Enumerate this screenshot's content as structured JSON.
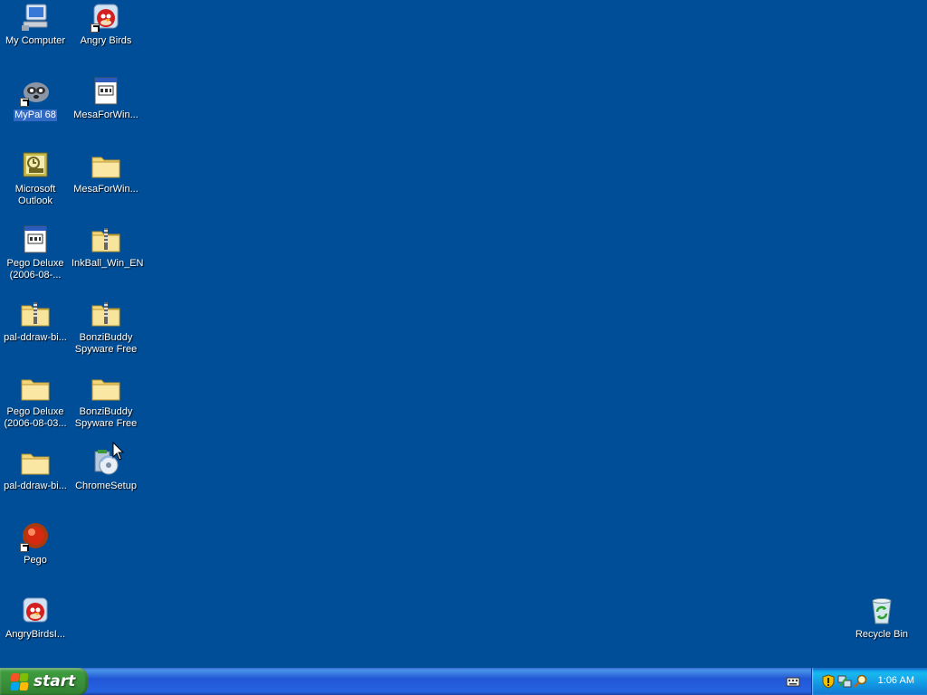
{
  "desktop": {
    "background_color": "#004e98",
    "icons": [
      {
        "label": "My Computer",
        "icon": "my-computer-icon"
      },
      {
        "label": "Angry Birds",
        "icon": "angry-birds-icon",
        "shortcut": true
      },
      {
        "label": "MyPal 68",
        "icon": "mypal-icon",
        "shortcut": true,
        "selected": true
      },
      {
        "label": "MesaForWin...",
        "icon": "program-window-icon"
      },
      {
        "label": "Microsoft Outlook",
        "icon": "outlook-icon"
      },
      {
        "label": "MesaForWin...",
        "icon": "folder-icon"
      },
      {
        "label": "Pego Deluxe (2006-08-...",
        "icon": "program-window-icon"
      },
      {
        "label": "InkBall_Win_EN",
        "icon": "zip-folder-icon"
      },
      {
        "label": "pal-ddraw-bi...",
        "icon": "zip-folder-icon"
      },
      {
        "label": "BonziBuddy Spyware Free",
        "icon": "zip-folder-icon"
      },
      {
        "label": "Pego Deluxe (2006-08-03...",
        "icon": "folder-icon"
      },
      {
        "label": "BonziBuddy Spyware Free",
        "icon": "folder-icon"
      },
      {
        "label": "pal-ddraw-bi...",
        "icon": "folder-icon"
      },
      {
        "label": "ChromeSetup",
        "icon": "installer-icon"
      },
      {
        "label": "Pego",
        "icon": "pego-icon",
        "shortcut": true
      },
      {
        "label": "AngryBirdsI...",
        "icon": "angry-birds-icon"
      },
      {
        "label": "Recycle Bin",
        "icon": "recycle-bin-icon"
      }
    ]
  },
  "taskbar": {
    "start_label": "start",
    "tray": {
      "clock": "1:06 AM",
      "icons": [
        "security-shield-icon",
        "network-icon",
        "search-icon"
      ]
    }
  }
}
